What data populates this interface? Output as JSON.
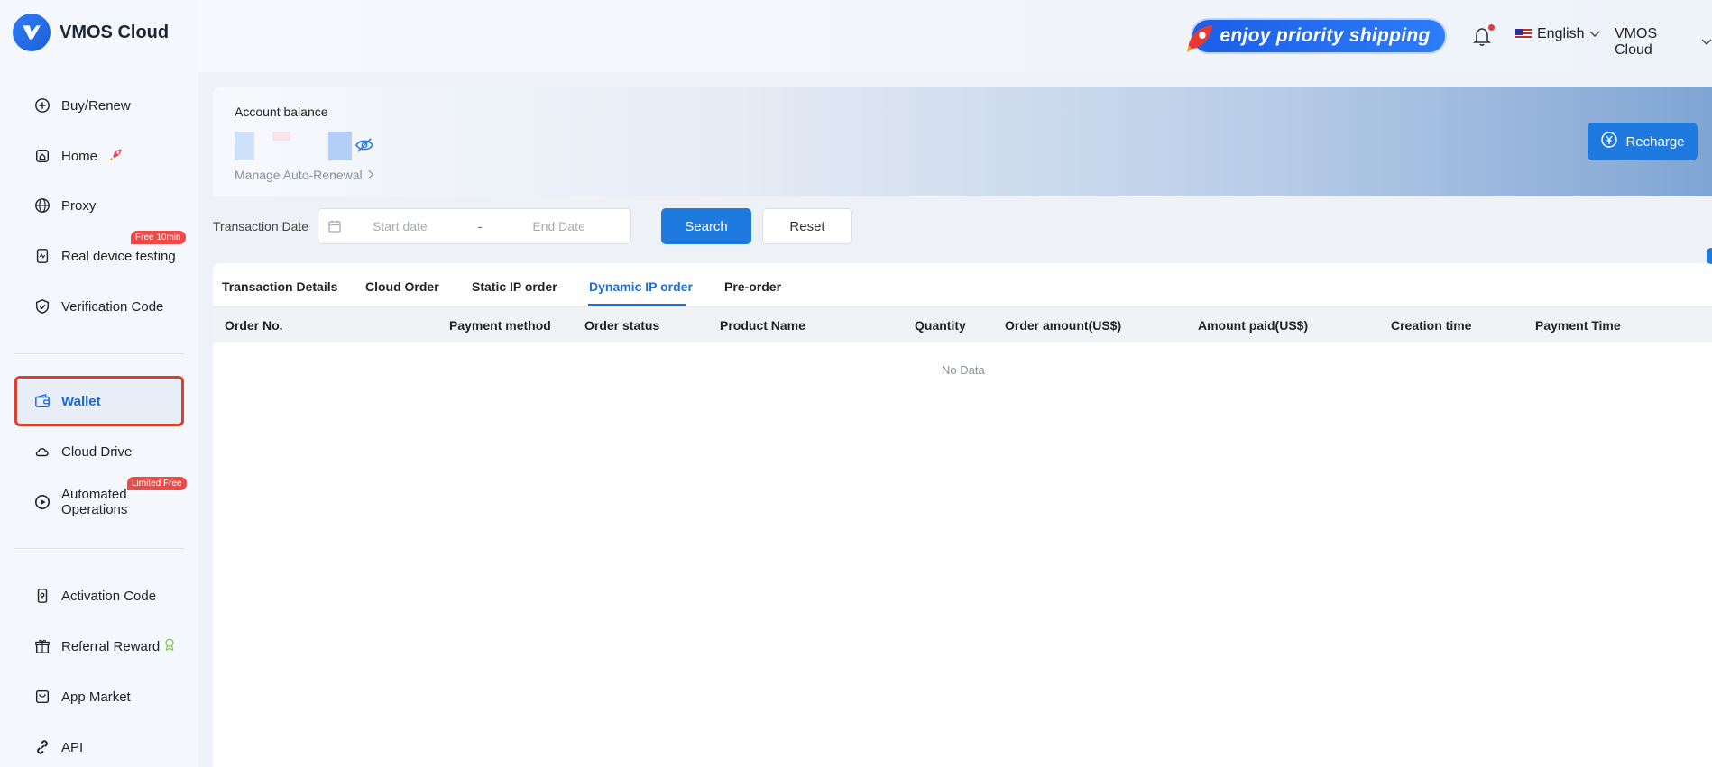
{
  "brand": {
    "name": "VMOS Cloud"
  },
  "sidebar": {
    "items": [
      {
        "label": "Buy/Renew",
        "icon": "plus-circle-icon"
      },
      {
        "label": "Home",
        "icon": "home-icon"
      },
      {
        "label": "Proxy",
        "icon": "globe-icon"
      },
      {
        "label": "Real device testing",
        "icon": "device-icon",
        "badge": "Free 10min"
      },
      {
        "label": "Verification Code",
        "icon": "shield-check-icon"
      },
      {
        "label": "Wallet",
        "icon": "wallet-icon",
        "active": true
      },
      {
        "label": "Cloud Drive",
        "icon": "cloud-icon"
      },
      {
        "label": "Automated Operations",
        "icon": "play-circle-icon",
        "badge": "Limited Free"
      },
      {
        "label": "Activation Code",
        "icon": "key-card-icon"
      },
      {
        "label": "Referral Reward",
        "icon": "gift-icon"
      },
      {
        "label": "App Market",
        "icon": "store-icon"
      },
      {
        "label": "API",
        "icon": "link-icon"
      }
    ]
  },
  "header": {
    "promo_text": "enjoy priority shipping",
    "language": "English",
    "user": "VMOS Cloud"
  },
  "balance": {
    "label": "Account balance",
    "manage_label": "Manage Auto-Renewal",
    "recharge_label": "Recharge"
  },
  "filter": {
    "label": "Transaction Date",
    "start_placeholder": "Start date",
    "separator": "-",
    "end_placeholder": "End Date",
    "search_label": "Search",
    "reset_label": "Reset"
  },
  "tabs": [
    {
      "label": "Transaction Details"
    },
    {
      "label": "Cloud Order"
    },
    {
      "label": "Static IP order"
    },
    {
      "label": "Dynamic IP order",
      "active": true
    },
    {
      "label": "Pre-order"
    }
  ],
  "table": {
    "columns": [
      "Order No.",
      "Payment method",
      "Order status",
      "Product Name",
      "Quantity",
      "Order amount(US$)",
      "Amount paid(US$)",
      "Creation time",
      "Payment Time"
    ],
    "empty_text": "No Data"
  },
  "colors": {
    "accent": "#1f7ae0",
    "active_tab": "#1f6fd6",
    "highlight_border": "#d9412f",
    "badge": "#ef4a4a"
  }
}
